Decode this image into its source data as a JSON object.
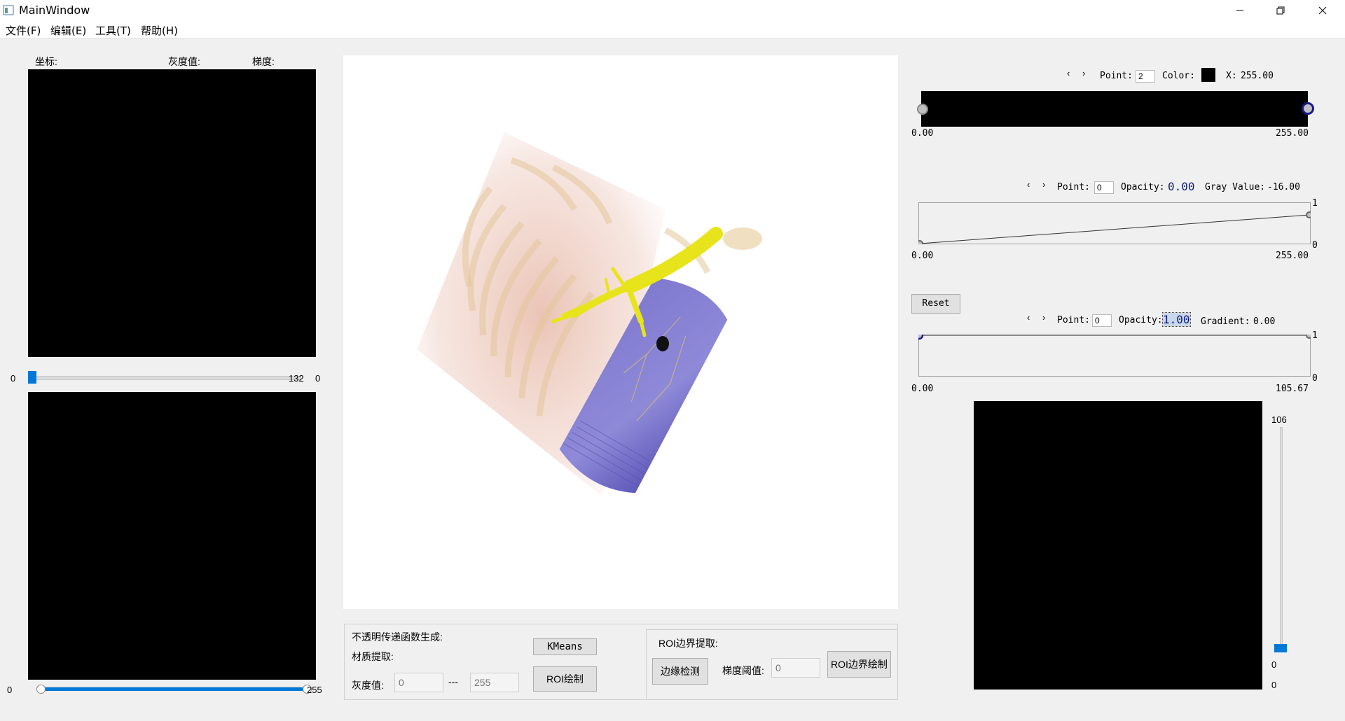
{
  "window": {
    "title": "MainWindow",
    "minimize_icon": "minimize-icon",
    "maximize_icon": "restore-icon",
    "close_icon": "close-icon"
  },
  "menu": [
    "文件(F)",
    "编辑(E)",
    "工具(T)",
    "帮助(H)"
  ],
  "left_panel": {
    "coord_label": "坐标:",
    "gray_label": "灰度值:",
    "gradient_label": "梯度:",
    "slice_slider": {
      "min_label": "0",
      "value_label": "132",
      "right_label": "0",
      "value_fraction": 0.0
    },
    "range_slider": {
      "min_label": "0",
      "max_label": "255",
      "low_fraction": 0.0,
      "high_fraction": 1.0
    }
  },
  "bottom_controls": {
    "opacity_tf_label": "不透明传递函数生成:",
    "material_label": "材质提取:",
    "gray_value_label": "灰度值:",
    "gray_min_placeholder": "0",
    "gray_sep": "---",
    "gray_max_placeholder": "255",
    "kmeans_button": "KMeans",
    "roi_draw_button": "ROI绘制",
    "roi_boundary_label": "ROI边界提取:",
    "edge_detect_button": "边缘检测",
    "gradient_threshold_label": "梯度阈值:",
    "gradient_threshold_placeholder": "0",
    "roi_boundary_draw_button": "ROI边界绘制"
  },
  "color_tf": {
    "prev": "‹",
    "next": "›",
    "point_label": "Point:",
    "point_value": "2",
    "color_label": "Color:",
    "color_swatch": "#000000",
    "x_label": "X:",
    "x_value": "255.00",
    "axis_min": "0.00",
    "axis_max": "255.00"
  },
  "scalar_opacity_tf": {
    "prev": "‹",
    "next": "›",
    "point_label": "Point:",
    "point_value": "0",
    "opacity_label": "Opacity:",
    "opacity_value": "0.00",
    "gray_value_label": "Gray Value:",
    "gray_value": "-16.00",
    "axis_min": "0.00",
    "axis_max": "255.00",
    "y_top": "1",
    "y_bottom": "0"
  },
  "gradient_opacity_tf": {
    "reset_button": "Reset",
    "prev": "‹",
    "next": "›",
    "point_label": "Point:",
    "point_value": "0",
    "opacity_label": "Opacity:",
    "opacity_value": "1.00",
    "gradient_label": "Gradient:",
    "gradient_value": "0.00",
    "axis_min": "0.00",
    "axis_max": "105.67",
    "y_top": "1",
    "y_bottom": "0"
  },
  "histogram": {
    "slider_max_label": "106",
    "slider_value_label": "0",
    "slider_min_label": "0",
    "value_fraction": 0.0
  },
  "colors": {
    "accent": "#0078d7",
    "lung": "#8c86d6",
    "airway": "#e6e61c",
    "bone": "#e9c7a6"
  }
}
